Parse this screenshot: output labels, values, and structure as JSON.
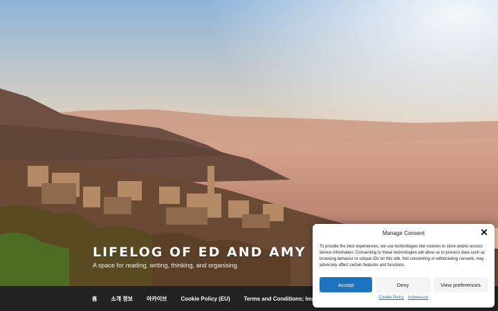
{
  "site": {
    "title": "LIFELOG OF ED AND AMY",
    "description": "A space for reading, writing, thinking, and organising."
  },
  "nav": {
    "items": [
      {
        "label": "홈"
      },
      {
        "label": "소개 정보"
      },
      {
        "label": "아카이브"
      },
      {
        "label": "Cookie Policy (EU)"
      },
      {
        "label": "Terms and Conditions; Imprint"
      }
    ]
  },
  "consent": {
    "title": "Manage Consent",
    "text": "To provide the best experiences, we use technologies like cookies to store and/or access device information. Consenting to these technologies will allow us to process data such as browsing behavior or unique IDs on this site. Not consenting or withdrawing consent, may adversely affect certain features and functions.",
    "accept_label": "Accept",
    "deny_label": "Deny",
    "prefs_label": "View preferences",
    "cookie_policy_link": "Cookie Policy",
    "impressum_link": "Impressum",
    "close_icon": "close-icon"
  },
  "colors": {
    "accent": "#1e73be",
    "nav_bg": "#222222",
    "consent_bg": "#ffffff"
  }
}
